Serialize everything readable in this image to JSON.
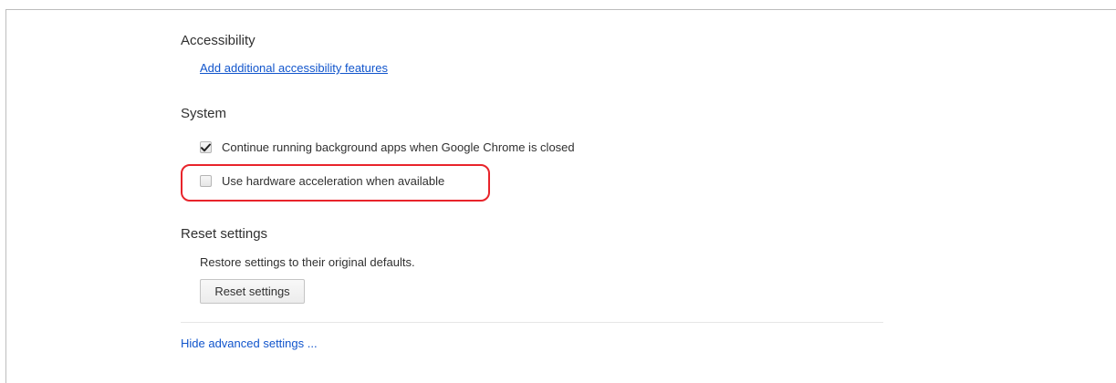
{
  "accessibility": {
    "title": "Accessibility",
    "link_label": "Add additional accessibility features"
  },
  "system": {
    "title": "System",
    "options": [
      {
        "label": "Continue running background apps when Google Chrome is closed",
        "checked": true
      },
      {
        "label": "Use hardware acceleration when available",
        "checked": false
      }
    ]
  },
  "reset": {
    "title": "Reset settings",
    "description": "Restore settings to their original defaults.",
    "button_label": "Reset settings"
  },
  "footer": {
    "hide_advanced_label": "Hide advanced settings ..."
  },
  "colors": {
    "link": "#1155cc",
    "highlight": "#e8242b",
    "text": "#303030"
  },
  "icons": {
    "checkmark": "checkmark-icon"
  }
}
